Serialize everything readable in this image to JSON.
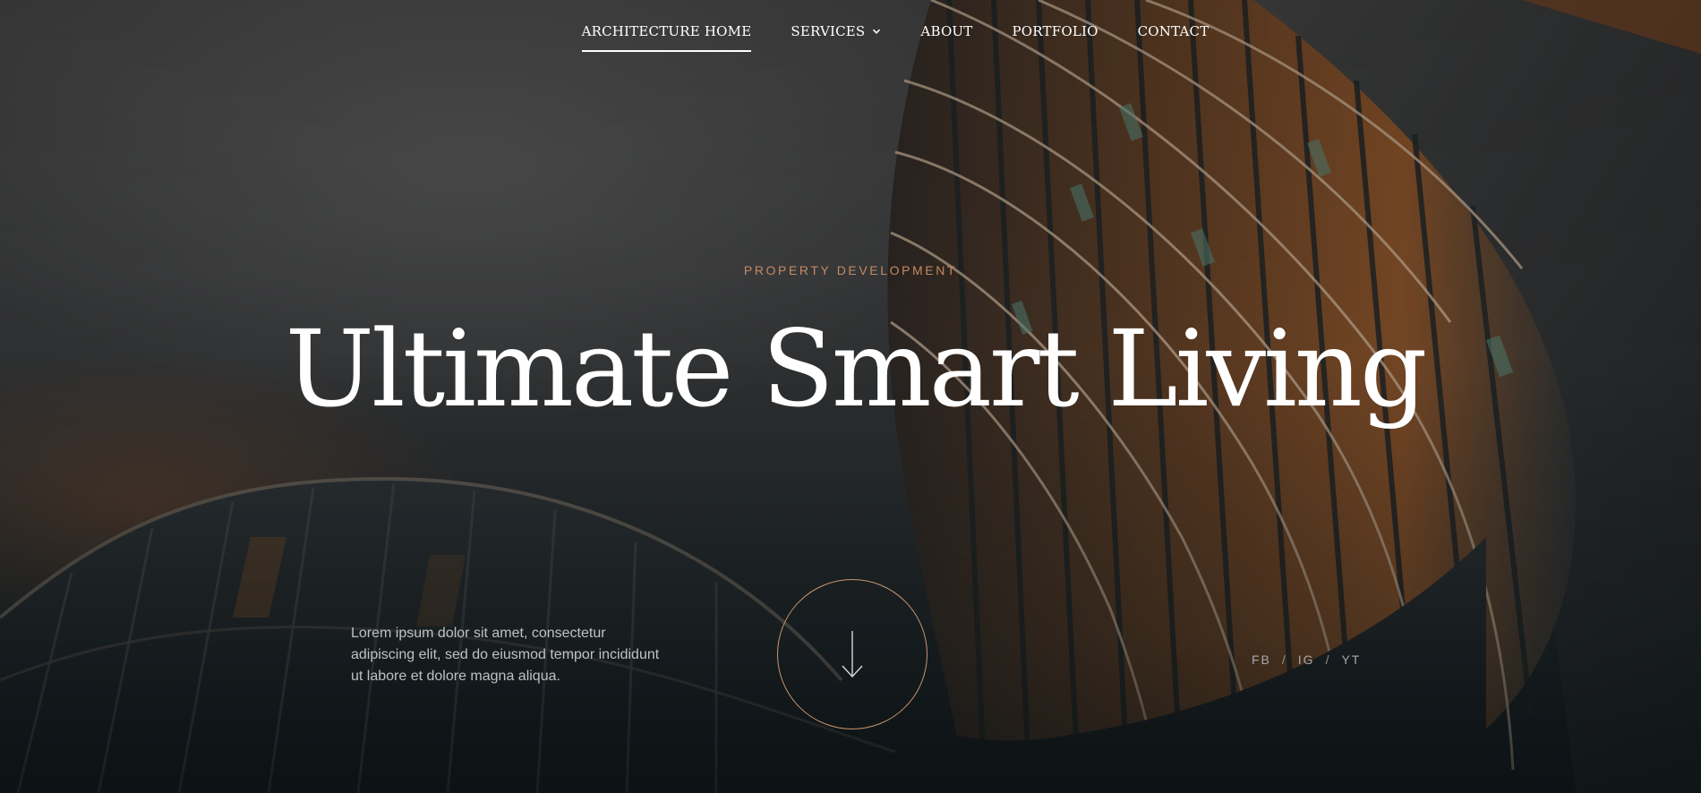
{
  "nav": {
    "items": [
      {
        "label": "ARCHITECTURE HOME",
        "active": true
      },
      {
        "label": "SERVICES",
        "has_dropdown": true
      },
      {
        "label": "ABOUT"
      },
      {
        "label": "PORTFOLIO"
      },
      {
        "label": "CONTACT"
      }
    ]
  },
  "hero": {
    "eyebrow": "PROPERTY DEVELOPMENT",
    "title": "Ultimate Smart Living",
    "lead": "Lorem ipsum dolor sit amet, consectetur adipiscing elit, sed do eiusmod tempor incididunt ut labore et dolore magna aliqua.",
    "scroll_icon": "arrow-down-icon"
  },
  "socials": {
    "items": [
      "FB",
      "IG",
      "YT"
    ],
    "separator": "/"
  },
  "colors": {
    "accent": "#c28a63",
    "ring": "#c9946e",
    "text": "#ffffff",
    "muted": "#bfc2c3"
  }
}
